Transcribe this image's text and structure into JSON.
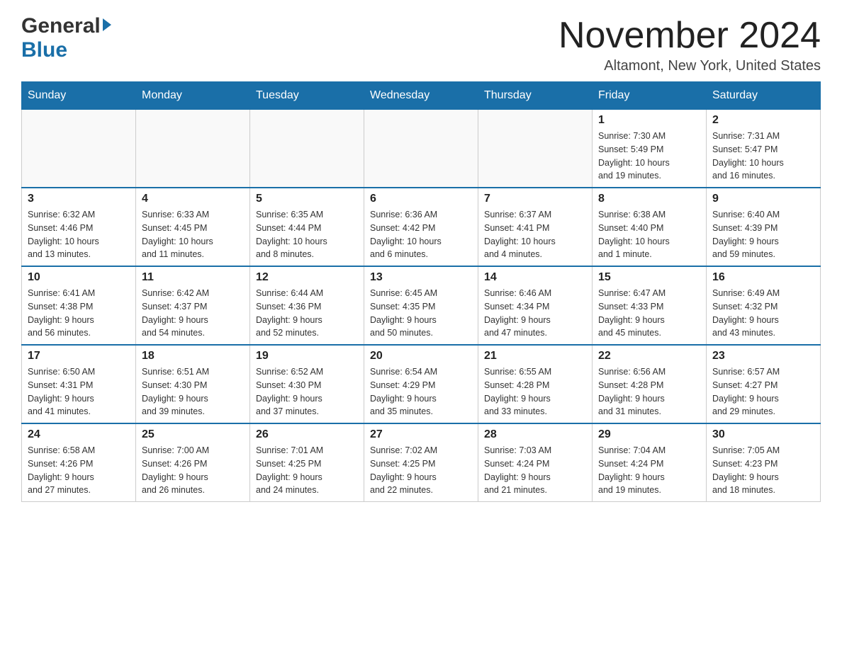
{
  "header": {
    "logo_general": "General",
    "logo_blue": "Blue",
    "month_title": "November 2024",
    "location": "Altamont, New York, United States"
  },
  "days_of_week": [
    "Sunday",
    "Monday",
    "Tuesday",
    "Wednesday",
    "Thursday",
    "Friday",
    "Saturday"
  ],
  "weeks": [
    [
      {
        "day": "",
        "info": ""
      },
      {
        "day": "",
        "info": ""
      },
      {
        "day": "",
        "info": ""
      },
      {
        "day": "",
        "info": ""
      },
      {
        "day": "",
        "info": ""
      },
      {
        "day": "1",
        "info": "Sunrise: 7:30 AM\nSunset: 5:49 PM\nDaylight: 10 hours\nand 19 minutes."
      },
      {
        "day": "2",
        "info": "Sunrise: 7:31 AM\nSunset: 5:47 PM\nDaylight: 10 hours\nand 16 minutes."
      }
    ],
    [
      {
        "day": "3",
        "info": "Sunrise: 6:32 AM\nSunset: 4:46 PM\nDaylight: 10 hours\nand 13 minutes."
      },
      {
        "day": "4",
        "info": "Sunrise: 6:33 AM\nSunset: 4:45 PM\nDaylight: 10 hours\nand 11 minutes."
      },
      {
        "day": "5",
        "info": "Sunrise: 6:35 AM\nSunset: 4:44 PM\nDaylight: 10 hours\nand 8 minutes."
      },
      {
        "day": "6",
        "info": "Sunrise: 6:36 AM\nSunset: 4:42 PM\nDaylight: 10 hours\nand 6 minutes."
      },
      {
        "day": "7",
        "info": "Sunrise: 6:37 AM\nSunset: 4:41 PM\nDaylight: 10 hours\nand 4 minutes."
      },
      {
        "day": "8",
        "info": "Sunrise: 6:38 AM\nSunset: 4:40 PM\nDaylight: 10 hours\nand 1 minute."
      },
      {
        "day": "9",
        "info": "Sunrise: 6:40 AM\nSunset: 4:39 PM\nDaylight: 9 hours\nand 59 minutes."
      }
    ],
    [
      {
        "day": "10",
        "info": "Sunrise: 6:41 AM\nSunset: 4:38 PM\nDaylight: 9 hours\nand 56 minutes."
      },
      {
        "day": "11",
        "info": "Sunrise: 6:42 AM\nSunset: 4:37 PM\nDaylight: 9 hours\nand 54 minutes."
      },
      {
        "day": "12",
        "info": "Sunrise: 6:44 AM\nSunset: 4:36 PM\nDaylight: 9 hours\nand 52 minutes."
      },
      {
        "day": "13",
        "info": "Sunrise: 6:45 AM\nSunset: 4:35 PM\nDaylight: 9 hours\nand 50 minutes."
      },
      {
        "day": "14",
        "info": "Sunrise: 6:46 AM\nSunset: 4:34 PM\nDaylight: 9 hours\nand 47 minutes."
      },
      {
        "day": "15",
        "info": "Sunrise: 6:47 AM\nSunset: 4:33 PM\nDaylight: 9 hours\nand 45 minutes."
      },
      {
        "day": "16",
        "info": "Sunrise: 6:49 AM\nSunset: 4:32 PM\nDaylight: 9 hours\nand 43 minutes."
      }
    ],
    [
      {
        "day": "17",
        "info": "Sunrise: 6:50 AM\nSunset: 4:31 PM\nDaylight: 9 hours\nand 41 minutes."
      },
      {
        "day": "18",
        "info": "Sunrise: 6:51 AM\nSunset: 4:30 PM\nDaylight: 9 hours\nand 39 minutes."
      },
      {
        "day": "19",
        "info": "Sunrise: 6:52 AM\nSunset: 4:30 PM\nDaylight: 9 hours\nand 37 minutes."
      },
      {
        "day": "20",
        "info": "Sunrise: 6:54 AM\nSunset: 4:29 PM\nDaylight: 9 hours\nand 35 minutes."
      },
      {
        "day": "21",
        "info": "Sunrise: 6:55 AM\nSunset: 4:28 PM\nDaylight: 9 hours\nand 33 minutes."
      },
      {
        "day": "22",
        "info": "Sunrise: 6:56 AM\nSunset: 4:28 PM\nDaylight: 9 hours\nand 31 minutes."
      },
      {
        "day": "23",
        "info": "Sunrise: 6:57 AM\nSunset: 4:27 PM\nDaylight: 9 hours\nand 29 minutes."
      }
    ],
    [
      {
        "day": "24",
        "info": "Sunrise: 6:58 AM\nSunset: 4:26 PM\nDaylight: 9 hours\nand 27 minutes."
      },
      {
        "day": "25",
        "info": "Sunrise: 7:00 AM\nSunset: 4:26 PM\nDaylight: 9 hours\nand 26 minutes."
      },
      {
        "day": "26",
        "info": "Sunrise: 7:01 AM\nSunset: 4:25 PM\nDaylight: 9 hours\nand 24 minutes."
      },
      {
        "day": "27",
        "info": "Sunrise: 7:02 AM\nSunset: 4:25 PM\nDaylight: 9 hours\nand 22 minutes."
      },
      {
        "day": "28",
        "info": "Sunrise: 7:03 AM\nSunset: 4:24 PM\nDaylight: 9 hours\nand 21 minutes."
      },
      {
        "day": "29",
        "info": "Sunrise: 7:04 AM\nSunset: 4:24 PM\nDaylight: 9 hours\nand 19 minutes."
      },
      {
        "day": "30",
        "info": "Sunrise: 7:05 AM\nSunset: 4:23 PM\nDaylight: 9 hours\nand 18 minutes."
      }
    ]
  ]
}
